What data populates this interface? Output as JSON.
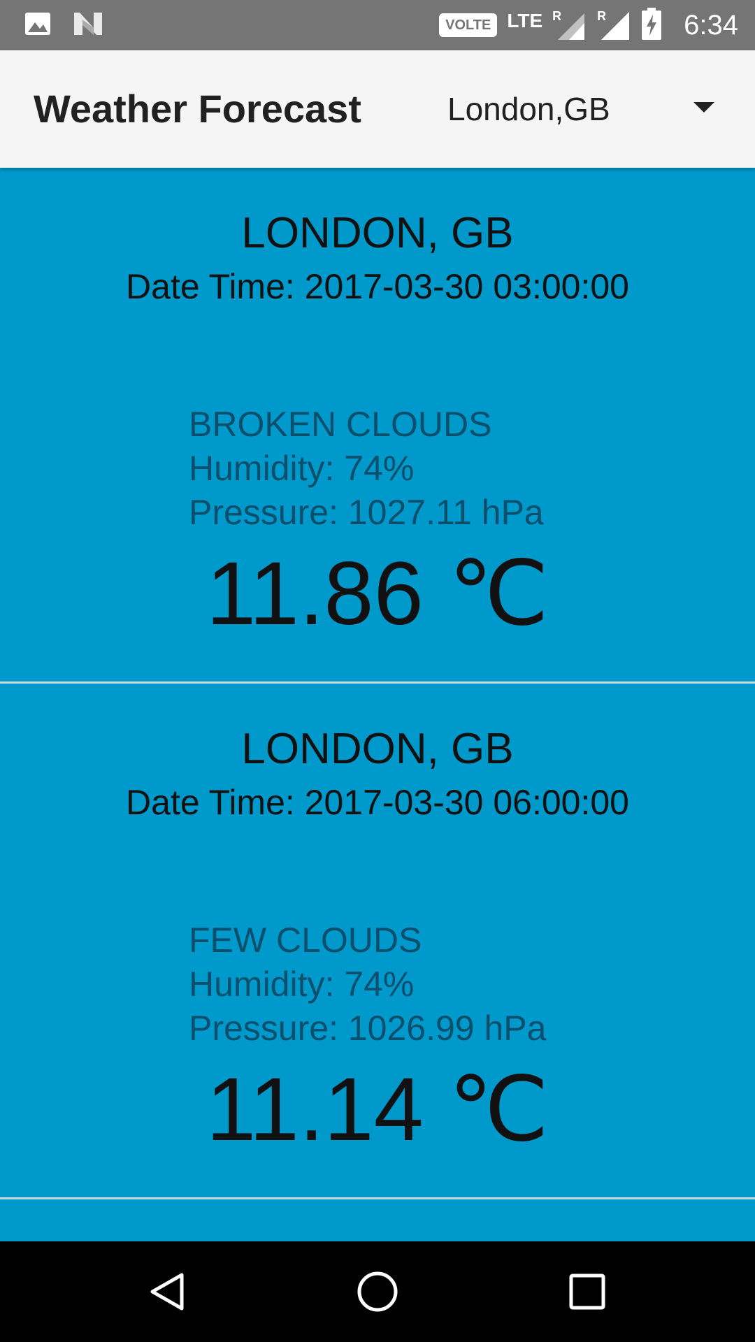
{
  "status_bar": {
    "time": "6:34",
    "volte": "VOLTE",
    "network": "LTE",
    "roaming": "R",
    "icons": [
      "image-icon",
      "n-logo-icon",
      "signal-icon",
      "battery-charging-icon"
    ]
  },
  "app_bar": {
    "title": "Weather Forecast",
    "location_select": {
      "selected": "London,GB"
    }
  },
  "forecasts": [
    {
      "city": "LONDON, GB",
      "datetime": "Date Time: 2017-03-30 03:00:00",
      "description": "BROKEN CLOUDS",
      "humidity": "Humidity: 74%",
      "pressure": "Pressure: 1027.11 hPa",
      "temperature": "11.86 ℃"
    },
    {
      "city": "LONDON, GB",
      "datetime": "Date Time: 2017-03-30 06:00:00",
      "description": "FEW CLOUDS",
      "humidity": "Humidity: 74%",
      "pressure": "Pressure: 1026.99 hPa",
      "temperature": "11.14 ℃"
    }
  ],
  "nav_bar": {
    "icons": [
      "back-icon",
      "home-icon",
      "recents-icon"
    ]
  },
  "colors": {
    "card_background": "#0099cc",
    "app_bar": "#f5f5f5",
    "status_bar": "#757575",
    "details_text": "#0b4f6c"
  }
}
